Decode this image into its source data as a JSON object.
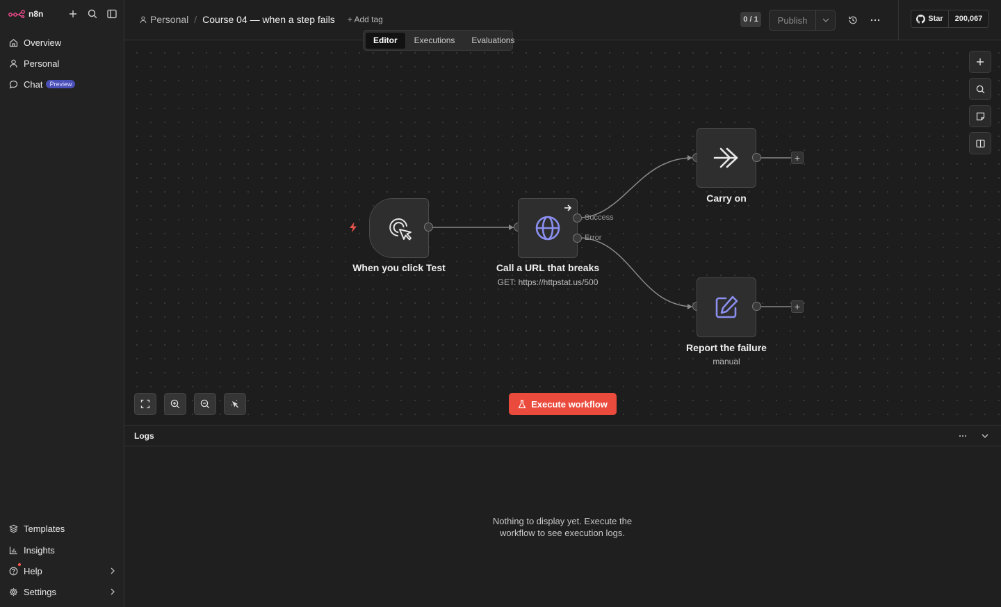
{
  "app": {
    "name": "n8n"
  },
  "sidebar": {
    "top_items": [
      {
        "label": "Overview",
        "icon": "home-icon"
      },
      {
        "label": "Personal",
        "icon": "user-icon"
      },
      {
        "label": "Chat",
        "icon": "chat-icon",
        "badge": "Preview"
      }
    ],
    "bottom_items": [
      {
        "label": "Templates",
        "icon": "templates-icon"
      },
      {
        "label": "Insights",
        "icon": "chart-icon"
      },
      {
        "label": "Help",
        "icon": "help-icon",
        "has_chevron": true,
        "notification_dot": true
      },
      {
        "label": "Settings",
        "icon": "gear-icon",
        "has_chevron": true
      }
    ]
  },
  "header": {
    "breadcrumb": {
      "project": "Personal",
      "separator": "/",
      "workflow_title": "Course 04 — when a step fails"
    },
    "add_tag": "+ Add tag",
    "version_badge": "0 / 1",
    "publish_label": "Publish",
    "github": {
      "star_label": "Star",
      "count": "200,067"
    }
  },
  "tabs": [
    {
      "label": "Editor",
      "active": true
    },
    {
      "label": "Executions",
      "active": false
    },
    {
      "label": "Evaluations",
      "active": false
    }
  ],
  "nodes": {
    "trigger": {
      "label": "When you click Test",
      "icon": "cursor-click-icon"
    },
    "http": {
      "label": "Call a URL that breaks",
      "subtitle": "GET: https://httpstat.us/500",
      "icon": "globe-icon",
      "outputs": [
        "Success",
        "Error"
      ]
    },
    "carry_on": {
      "label": "Carry on",
      "icon": "arrow-right-icon"
    },
    "report": {
      "label": "Report the failure",
      "subtitle": "manual",
      "icon": "edit-icon"
    }
  },
  "canvas": {
    "execute_label": "Execute workflow"
  },
  "logs": {
    "title": "Logs",
    "empty_message": "Nothing to display yet. Execute the workflow to see execution logs."
  },
  "colors": {
    "accent": "#ea4b3c",
    "node_icon": "#8b8ff0",
    "badge": "#4b4fb8"
  }
}
